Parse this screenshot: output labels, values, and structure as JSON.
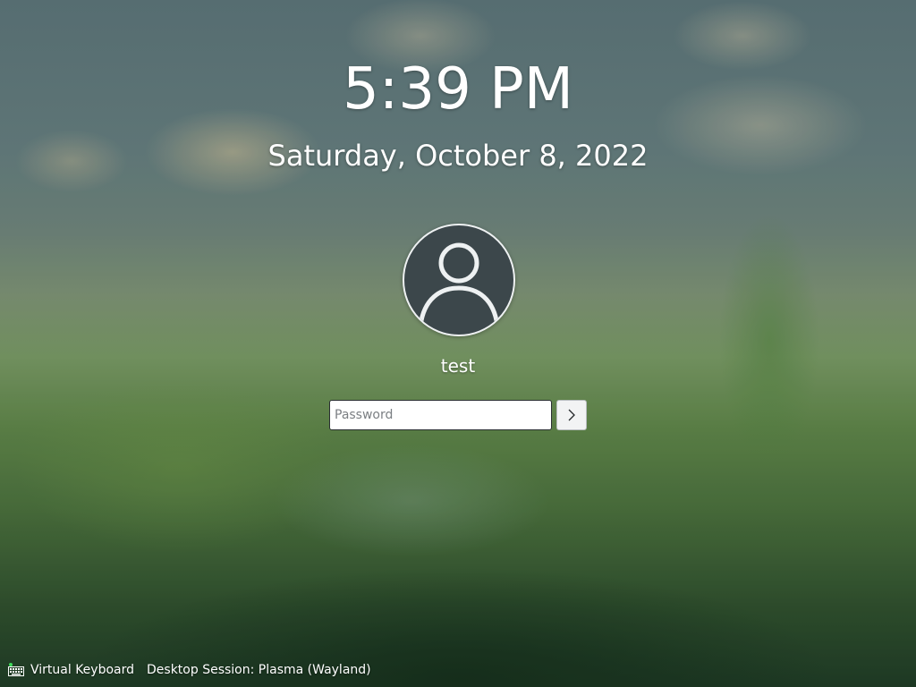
{
  "clock": {
    "time": "5:39 PM",
    "date": "Saturday, October 8, 2022"
  },
  "user": {
    "name": "test",
    "avatar_icon": "user-avatar-icon"
  },
  "login": {
    "password_placeholder": "Password",
    "password_value": "",
    "submit_icon": "chevron-right-icon"
  },
  "footer": {
    "virtual_keyboard_label": "Virtual Keyboard",
    "virtual_keyboard_icon": "keyboard-icon",
    "session_label": "Desktop Session: Plasma (Wayland)"
  },
  "colors": {
    "text": "#ffffff",
    "avatar_bg": "#3c474b",
    "status_dot": "#3ddc5a"
  }
}
